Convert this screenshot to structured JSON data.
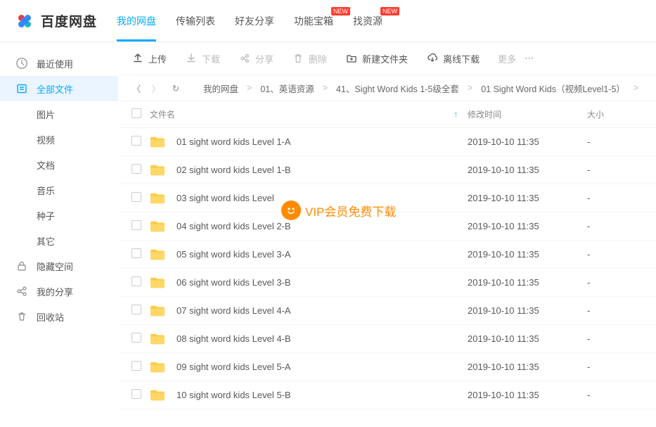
{
  "header": {
    "brand": "百度网盘",
    "tabs": [
      {
        "label": "我的网盘",
        "active": true
      },
      {
        "label": "传输列表"
      },
      {
        "label": "好友分享"
      },
      {
        "label": "功能宝箱",
        "badge": "NEW"
      },
      {
        "label": "找资源",
        "badge": "NEW"
      }
    ]
  },
  "sidebar": {
    "items": [
      {
        "icon": "clock",
        "label": "最近使用"
      },
      {
        "icon": "files",
        "label": "全部文件",
        "active": true
      },
      {
        "sub": true,
        "label": "图片"
      },
      {
        "sub": true,
        "label": "视频"
      },
      {
        "sub": true,
        "label": "文档"
      },
      {
        "sub": true,
        "label": "音乐"
      },
      {
        "sub": true,
        "label": "种子"
      },
      {
        "sub": true,
        "label": "其它"
      },
      {
        "icon": "lock",
        "label": "隐藏空间"
      },
      {
        "icon": "share",
        "label": "我的分享"
      },
      {
        "icon": "trash",
        "label": "回收站"
      }
    ]
  },
  "toolbar": {
    "upload": "上传",
    "download": "下载",
    "share": "分享",
    "delete": "删除",
    "new_folder": "新建文件夹",
    "offline_download": "离线下载",
    "more": "更多"
  },
  "breadcrumb": {
    "items": [
      "我的网盘",
      "01、英语资源",
      "41、Sight Word Kids 1-5级全套",
      "01 Sight Word Kids（视频Level1-5）"
    ]
  },
  "table": {
    "headers": {
      "name": "文件名",
      "date": "修改时间",
      "size": "大小"
    },
    "rows": [
      {
        "name": "01 sight word kids Level 1-A",
        "date": "2019-10-10 11:35",
        "size": "-"
      },
      {
        "name": "02 sight word kids Level 1-B",
        "date": "2019-10-10 11:35",
        "size": "-"
      },
      {
        "name": "03 sight word kids Level",
        "date": "2019-10-10 11:35",
        "size": "-"
      },
      {
        "name": "04 sight word kids Level 2-B",
        "date": "2019-10-10 11:35",
        "size": "-"
      },
      {
        "name": "05 sight word kids Level 3-A",
        "date": "2019-10-10 11:35",
        "size": "-"
      },
      {
        "name": "06 sight word kids Level 3-B",
        "date": "2019-10-10 11:35",
        "size": "-"
      },
      {
        "name": "07 sight word kids Level 4-A",
        "date": "2019-10-10 11:35",
        "size": "-"
      },
      {
        "name": "08 sight word kids Level 4-B",
        "date": "2019-10-10 11:35",
        "size": "-"
      },
      {
        "name": "09 sight word kids Level 5-A",
        "date": "2019-10-10 11:35",
        "size": "-"
      },
      {
        "name": "10 sight word kids Level 5-B",
        "date": "2019-10-10 11:35",
        "size": "-"
      }
    ]
  },
  "watermark": "VIP会员免费下载"
}
